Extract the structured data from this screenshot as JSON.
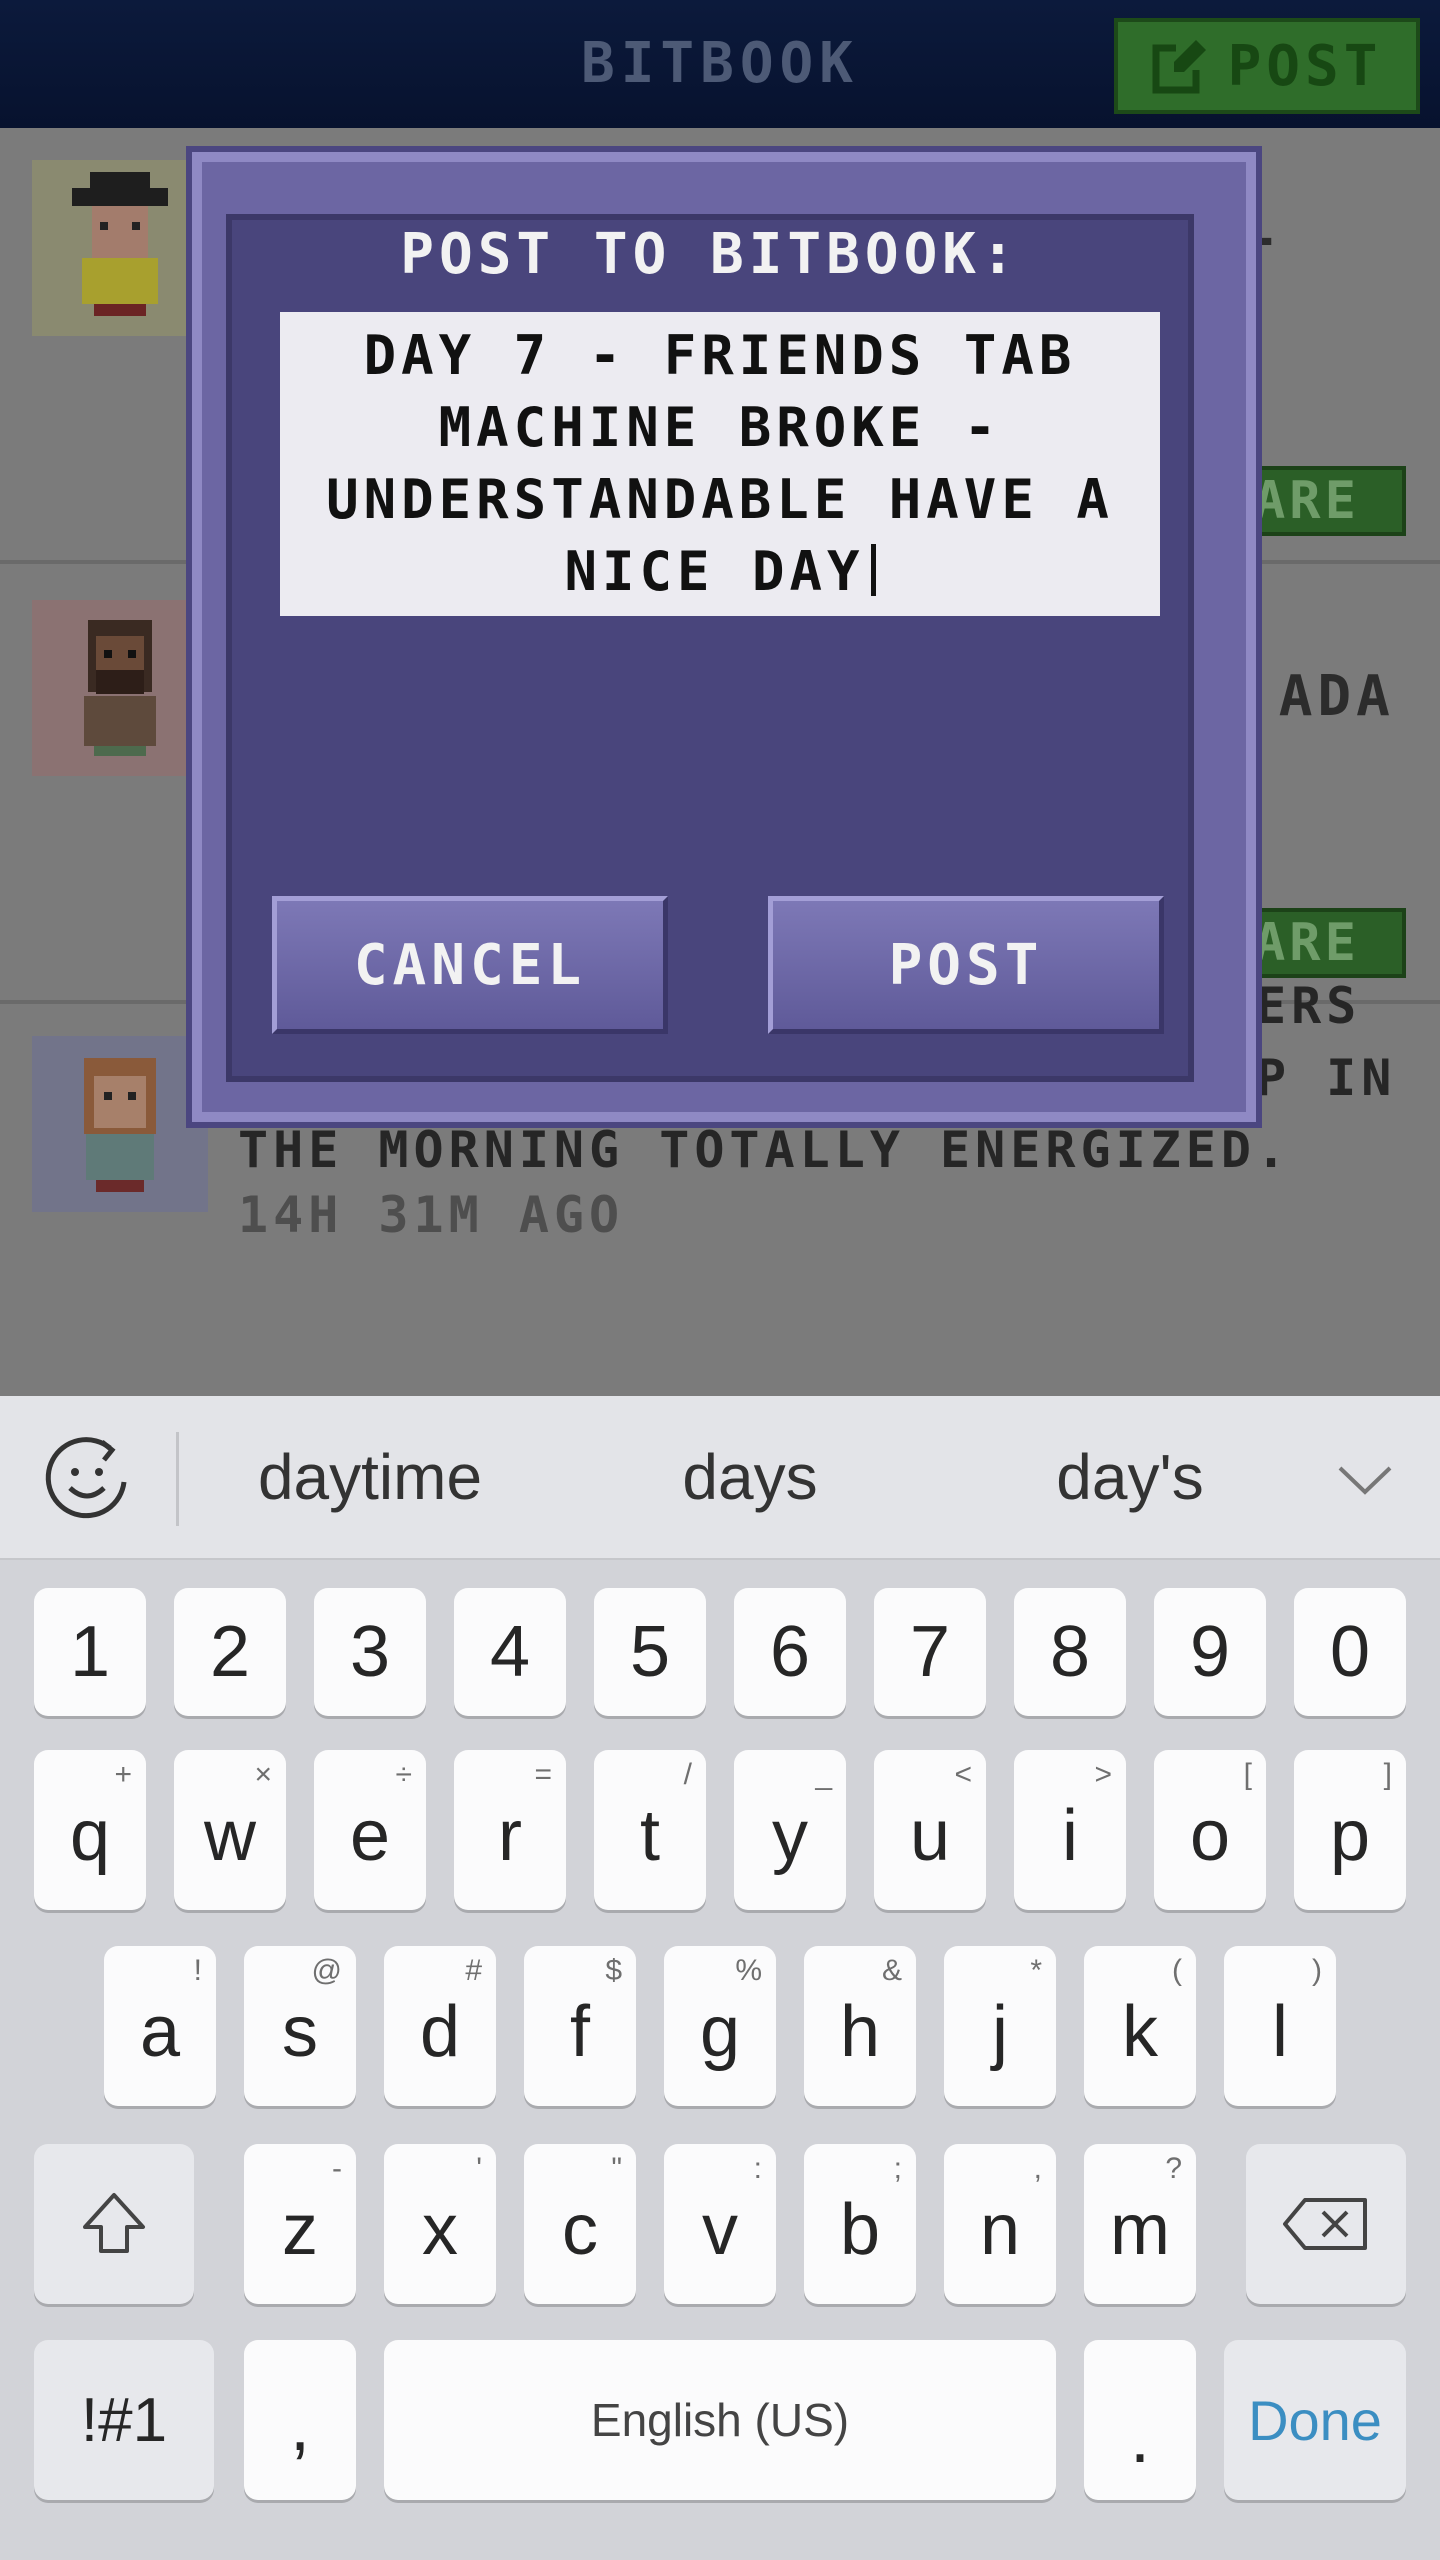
{
  "topbar": {
    "title": "BITBOOK",
    "post_label": "POST"
  },
  "feed": {
    "share_label_1": "ARE",
    "share_label_2": "ARE",
    "fragment_1": "T",
    "fragment_2": ".ADA",
    "post_text": "I INSTALLED 50 WIRELESS CHARGERS UNDER MY BED SO THAT I WAKE UP IN THE MORNING TOTALLY ENERGIZED.",
    "post_time": "14H 31M AGO"
  },
  "dialog": {
    "title": "POST TO BITBOOK:",
    "input_value": "DAY 7 - FRIENDS TAB MACHINE BROKE - UNDERSTANDABLE HAVE A NICE DAY",
    "cancel_label": "CANCEL",
    "post_label": "POST"
  },
  "keyboard": {
    "suggestions": [
      "daytime",
      "days",
      "day's"
    ],
    "number_row": [
      "1",
      "2",
      "3",
      "4",
      "5",
      "6",
      "7",
      "8",
      "9",
      "0"
    ],
    "row1": [
      {
        "k": "q",
        "s": "+"
      },
      {
        "k": "w",
        "s": "×"
      },
      {
        "k": "e",
        "s": "÷"
      },
      {
        "k": "r",
        "s": "="
      },
      {
        "k": "t",
        "s": "/"
      },
      {
        "k": "y",
        "s": "_"
      },
      {
        "k": "u",
        "s": "<"
      },
      {
        "k": "i",
        "s": ">"
      },
      {
        "k": "o",
        "s": "["
      },
      {
        "k": "p",
        "s": "]"
      }
    ],
    "row2": [
      {
        "k": "a",
        "s": "!"
      },
      {
        "k": "s",
        "s": "@"
      },
      {
        "k": "d",
        "s": "#"
      },
      {
        "k": "f",
        "s": "$"
      },
      {
        "k": "g",
        "s": "%"
      },
      {
        "k": "h",
        "s": "&"
      },
      {
        "k": "j",
        "s": "*"
      },
      {
        "k": "k",
        "s": "("
      },
      {
        "k": "l",
        "s": ")"
      }
    ],
    "row3": [
      {
        "k": "z",
        "s": "-"
      },
      {
        "k": "x",
        "s": "'"
      },
      {
        "k": "c",
        "s": "\""
      },
      {
        "k": "v",
        "s": ":"
      },
      {
        "k": "b",
        "s": ";"
      },
      {
        "k": "n",
        "s": ","
      },
      {
        "k": "m",
        "s": "?"
      }
    ],
    "symbols_label": "!#1",
    "comma_label": ",",
    "space_label": "English (US)",
    "period_label": ".",
    "done_label": "Done",
    "done_color": "#3b8ec2"
  }
}
